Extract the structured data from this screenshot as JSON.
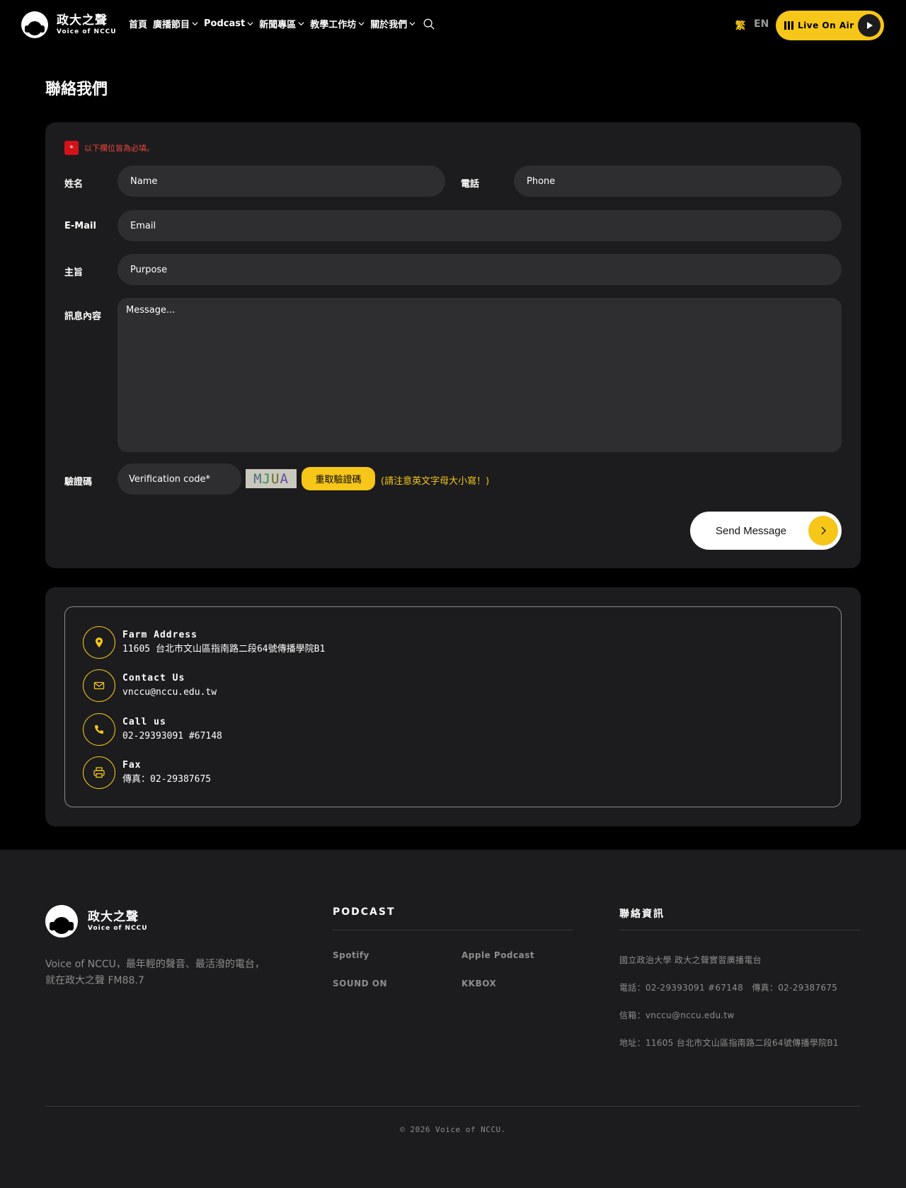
{
  "header": {
    "logo_cn": "政大之聲",
    "logo_en": "Voice of NCCU",
    "nav": [
      {
        "label": "首頁",
        "dropdown": false
      },
      {
        "label": "廣播節目",
        "dropdown": true
      },
      {
        "label": "Podcast",
        "dropdown": true
      },
      {
        "label": "新聞專區",
        "dropdown": true
      },
      {
        "label": "教學工作坊",
        "dropdown": true
      },
      {
        "label": "關於我們",
        "dropdown": true
      }
    ],
    "lang_zh": "繁",
    "lang_en": "EN",
    "live_label": "Live On Air"
  },
  "page": {
    "title": "聯絡我們"
  },
  "form": {
    "required_badge": "*",
    "required_note": "以下欄位皆為必填。",
    "name_label": "姓名",
    "name_placeholder": "Name",
    "phone_label": "電話",
    "phone_placeholder": "Phone",
    "email_label": "E-Mail",
    "email_placeholder": "Email",
    "purpose_label": "主旨",
    "purpose_placeholder": "Purpose",
    "message_label": "訊息內容",
    "message_placeholder": "Message...",
    "captcha_label": "驗證碼",
    "captcha_placeholder": "Verification code*",
    "captcha_chars": [
      "M",
      "J",
      "U",
      "A"
    ],
    "refresh_label": "重取驗證碼",
    "captcha_note": "(請注意英文字母大小寫！)",
    "send_label": "Send Message"
  },
  "info": {
    "items": [
      {
        "title": "Farm Address",
        "value": "11605 台北市文山區指南路二段64號傳播學院B1",
        "icon": "location-pin-icon"
      },
      {
        "title": "Contact Us",
        "value": "vnccu@nccu.edu.tw",
        "icon": "envelope-icon"
      },
      {
        "title": "Call us",
        "value": "02-29393091 #67148",
        "icon": "phone-icon"
      },
      {
        "title": "Fax",
        "value": "傳真：02-29387675",
        "icon": "printer-icon"
      }
    ]
  },
  "footer": {
    "logo_cn": "政大之聲",
    "logo_en": "Voice of NCCU",
    "desc_line1": "Voice of NCCU，最年輕的聲音、最活潑的電台，",
    "desc_line2": "就在政大之聲 FM88.7",
    "podcast_heading": "PODCAST",
    "podcast_links": [
      "Spotify",
      "Apple Podcast",
      "SOUND ON",
      "KKBOX"
    ],
    "contact_heading": "聯絡資訊",
    "contact_lines": [
      "國立政治大學 政大之聲實習廣播電台",
      "電話：02-29393091 #67148　傳真：02-29387675",
      "信箱：vnccu@nccu.edu.tw",
      "地址：11605 台北市文山區指南路二段64號傳播學院B1"
    ],
    "copyright": "© 2026 Voice of NCCU."
  },
  "colors": {
    "accent": "#f6c619",
    "card": "#1c1c1e",
    "field": "#2e2e31",
    "required": "#d3121a"
  }
}
